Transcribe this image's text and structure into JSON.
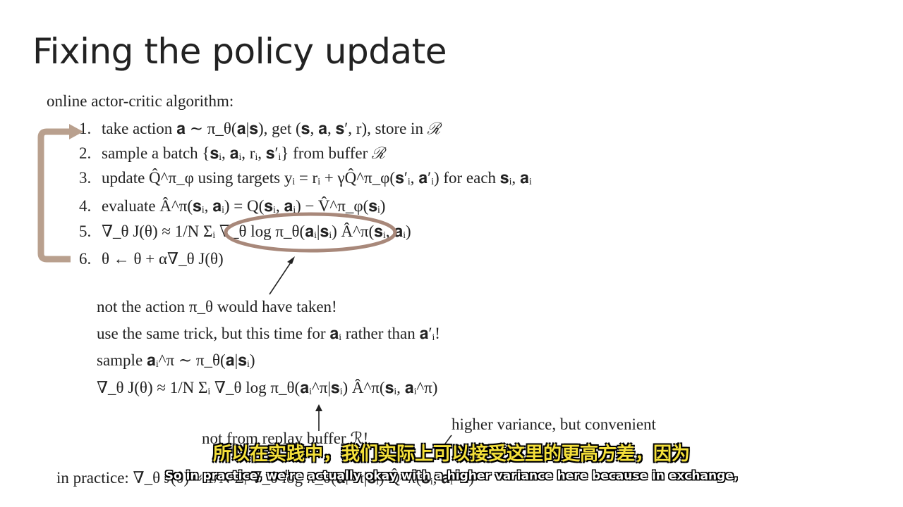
{
  "slide": {
    "title": "Fixing the policy update",
    "algorithm_heading": "online actor-critic algorithm:",
    "steps": [
      {
        "num": "1.",
        "text": "take action 𝐚 ∼ π_θ(𝐚|𝐬), get (𝐬, 𝐚, 𝐬′, r), store in ℛ"
      },
      {
        "num": "2.",
        "text": "sample a batch {𝐬ᵢ, 𝐚ᵢ, rᵢ, 𝐬′ᵢ} from buffer ℛ"
      },
      {
        "num": "3.",
        "text": "update Q̂^π_φ using targets yᵢ = rᵢ + γQ̂^π_φ(𝐬′ᵢ, 𝐚′ᵢ) for each 𝐬ᵢ, 𝐚ᵢ"
      },
      {
        "num": "4.",
        "text": "evaluate Â^π(𝐬ᵢ, 𝐚ᵢ) = Q(𝐬ᵢ, 𝐚ᵢ) − V̂^π_φ(𝐬ᵢ)"
      },
      {
        "num": "5.",
        "text": "∇_θ J(θ) ≈ 1/N Σᵢ ∇_θ log π_θ(𝐚ᵢ|𝐬ᵢ) Â^π(𝐬ᵢ, 𝐚ᵢ)"
      },
      {
        "num": "6.",
        "text": "θ ← θ + α∇_θ J(θ)"
      }
    ],
    "notes": [
      "not the action π_θ would have taken!",
      "use the same trick, but this time for 𝐚ᵢ rather than 𝐚′ᵢ!",
      "sample 𝐚ᵢ^π ∼ π_θ(𝐚|𝐬ᵢ)",
      "∇_θ J(θ) ≈ 1/N Σᵢ ∇_θ log π_θ(𝐚ᵢ^π|𝐬ᵢ) Â^π(𝐬ᵢ, 𝐚ᵢ^π)"
    ],
    "not_from_buffer": "not from replay buffer ℛ!",
    "higher_variance": "higher variance, but convenient",
    "in_practice": "in practice: ∇_θ J(θ) ≈ 1/N Σᵢ ∇_θ log π_θ(𝐚ᵢ^π|𝐬ᵢ) Q̂^π(𝐬ᵢ, 𝐚ᵢ^π)"
  },
  "subtitles": {
    "chinese": "所以在实践中，我们实际上可以接受这里的更高方差，因为",
    "english": "So in practice, we're actually okay with a higher variance here because in exchange,"
  },
  "colors": {
    "loop_arrow": "#b9a08e",
    "ellipse": "#a8887a",
    "subtitle_cn": "#f4e03a"
  }
}
